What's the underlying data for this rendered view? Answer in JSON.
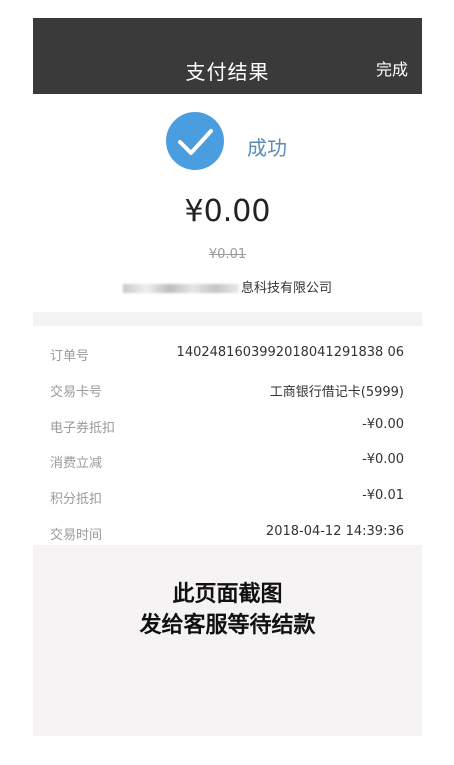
{
  "navbar": {
    "title": "支付结果",
    "done_label": "完成"
  },
  "result": {
    "status_text": "成功",
    "amount": "¥0.00",
    "original_amount": "¥0.01",
    "merchant_visible_part": "息科技有限公司"
  },
  "details": [
    {
      "label": "订单号",
      "value": "1402481603992018041291838 06"
    },
    {
      "label": "交易卡号",
      "value": "工商银行借记卡(5999)"
    },
    {
      "label": "电子券抵扣",
      "value": "-¥0.00"
    },
    {
      "label": "消费立减",
      "value": "-¥0.00"
    },
    {
      "label": "积分抵扣",
      "value": "-¥0.01"
    },
    {
      "label": "交易时间",
      "value": "2018-04-12 14:39:36"
    }
  ],
  "overlay": {
    "line1": "此页面截图",
    "line2": "发给客服等待结款"
  },
  "colors": {
    "navbar_bg": "#3a3a3a",
    "success_blue": "#4a9ee0",
    "success_text": "#5b8db8"
  },
  "icons": {
    "status": "checkmark-circle-icon"
  }
}
